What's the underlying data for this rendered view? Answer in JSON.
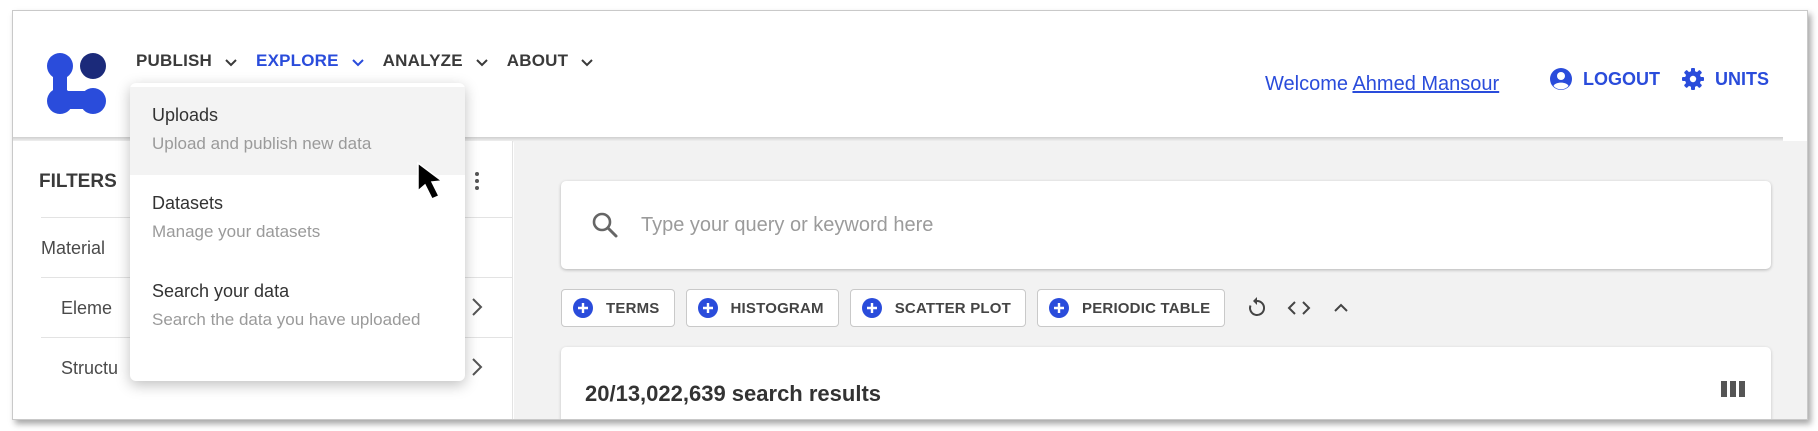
{
  "app": {
    "brand_colors": {
      "accent": "#2a4cdb",
      "highlight": "#ffff3a"
    }
  },
  "header": {
    "nav": [
      {
        "label": "PUBLISH",
        "active": false
      },
      {
        "label": "EXPLORE",
        "active": true
      },
      {
        "label": "ANALYZE",
        "active": false
      },
      {
        "label": "ABOUT",
        "active": false
      }
    ],
    "welcome_prefix": "Welcome",
    "user_name": "Ahmed Mansour",
    "logout_label": "LOGOUT",
    "units_label": "UNITS",
    "icons": {
      "logout": "account-circle-icon",
      "units": "gear-icon"
    }
  },
  "dropdown": {
    "items": [
      {
        "title": "Uploads",
        "subtitle": "Upload and publish new data",
        "highlighted": true
      },
      {
        "title": "Datasets",
        "subtitle": "Manage your datasets",
        "highlighted": false
      },
      {
        "title": "Search your data",
        "subtitle": "Search the data you have uploaded",
        "highlighted": false
      }
    ]
  },
  "filters": {
    "title": "FILTERS",
    "rows": [
      {
        "label": "Material"
      },
      {
        "label": "Eleme"
      },
      {
        "label": "Structu"
      }
    ]
  },
  "search": {
    "placeholder": "Type your query or keyword here"
  },
  "toolbar": {
    "chips": [
      {
        "label": "TERMS"
      },
      {
        "label": "HISTOGRAM"
      },
      {
        "label": "SCATTER PLOT"
      },
      {
        "label": "PERIODIC TABLE"
      }
    ],
    "icons": [
      "reset-icon",
      "code-icon",
      "collapse-icon"
    ]
  },
  "results": {
    "count_text": "20/13,022,639 search results"
  }
}
